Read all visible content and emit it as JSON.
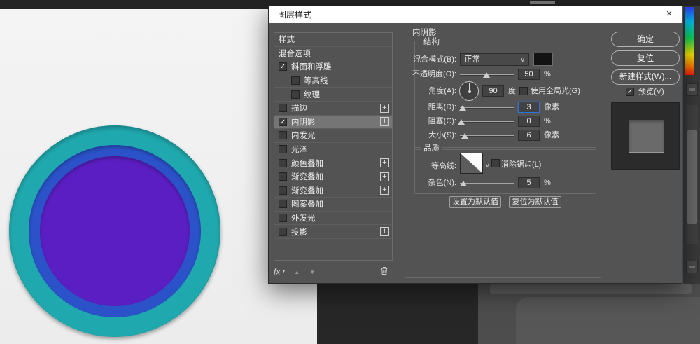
{
  "titlebar": {
    "title": "图层样式"
  },
  "icons": {
    "check": "✓",
    "plus": "+",
    "chevron": "∨",
    "up": "▲",
    "down": "▼",
    "close": "×",
    "fx": "fx",
    "fx_caret": "▼"
  },
  "styles_panel": {
    "header": "样式",
    "items": [
      {
        "id": "blending-options",
        "label": "混合选项"
      },
      {
        "id": "bevel-emboss",
        "label": "斜面和浮雕",
        "checked": true
      },
      {
        "id": "contour",
        "label": "等高线",
        "checked": false,
        "indent": true
      },
      {
        "id": "texture",
        "label": "纹理",
        "checked": false,
        "indent": true
      },
      {
        "id": "stroke",
        "label": "描边",
        "checked": false,
        "plus": true
      },
      {
        "id": "inner-shadow",
        "label": "内阴影",
        "checked": true,
        "plus": true,
        "selected": true
      },
      {
        "id": "inner-glow",
        "label": "内发光",
        "checked": false
      },
      {
        "id": "satin",
        "label": "光泽",
        "checked": false
      },
      {
        "id": "color-overlay",
        "label": "颜色叠加",
        "checked": false,
        "plus": true
      },
      {
        "id": "gradient-overlay-1",
        "label": "渐变叠加",
        "checked": false,
        "plus": true
      },
      {
        "id": "gradient-overlay-2",
        "label": "渐变叠加",
        "checked": false,
        "plus": true
      },
      {
        "id": "pattern-overlay",
        "label": "图案叠加",
        "checked": false
      },
      {
        "id": "outer-glow",
        "label": "外发光",
        "checked": false
      },
      {
        "id": "drop-shadow",
        "label": "投影",
        "checked": false,
        "plus": true
      }
    ]
  },
  "settings": {
    "title": "内阴影",
    "structure_legend": "结构",
    "blend_mode": {
      "label": "混合模式(B):",
      "value": "正常"
    },
    "opacity": {
      "label": "不透明度(O):",
      "value": "50",
      "unit": "%"
    },
    "angle": {
      "label": "角度(A):",
      "value": "90",
      "unit": "度",
      "global_light": "使用全局光(G)"
    },
    "distance": {
      "label": "距离(D):",
      "value": "3",
      "unit": "像素"
    },
    "choke": {
      "label": "阻塞(C):",
      "value": "0",
      "unit": "%"
    },
    "size": {
      "label": "大小(S):",
      "value": "6",
      "unit": "像素"
    },
    "quality_legend": "品质",
    "contour": {
      "label": "等高线:",
      "antialias": "消除锯齿(L)"
    },
    "noise": {
      "label": "杂色(N):",
      "value": "5",
      "unit": "%"
    },
    "set_default": "设置为默认值",
    "reset_default": "复位为默认值"
  },
  "actions": {
    "ok": "确定",
    "reset": "复位",
    "new_style": "新建样式(W)...",
    "preview": "预览(V)"
  },
  "canvas_colors": {
    "outer": "#1FA9AE",
    "ring": "#2B52C8",
    "core": "#5B1EC2"
  }
}
